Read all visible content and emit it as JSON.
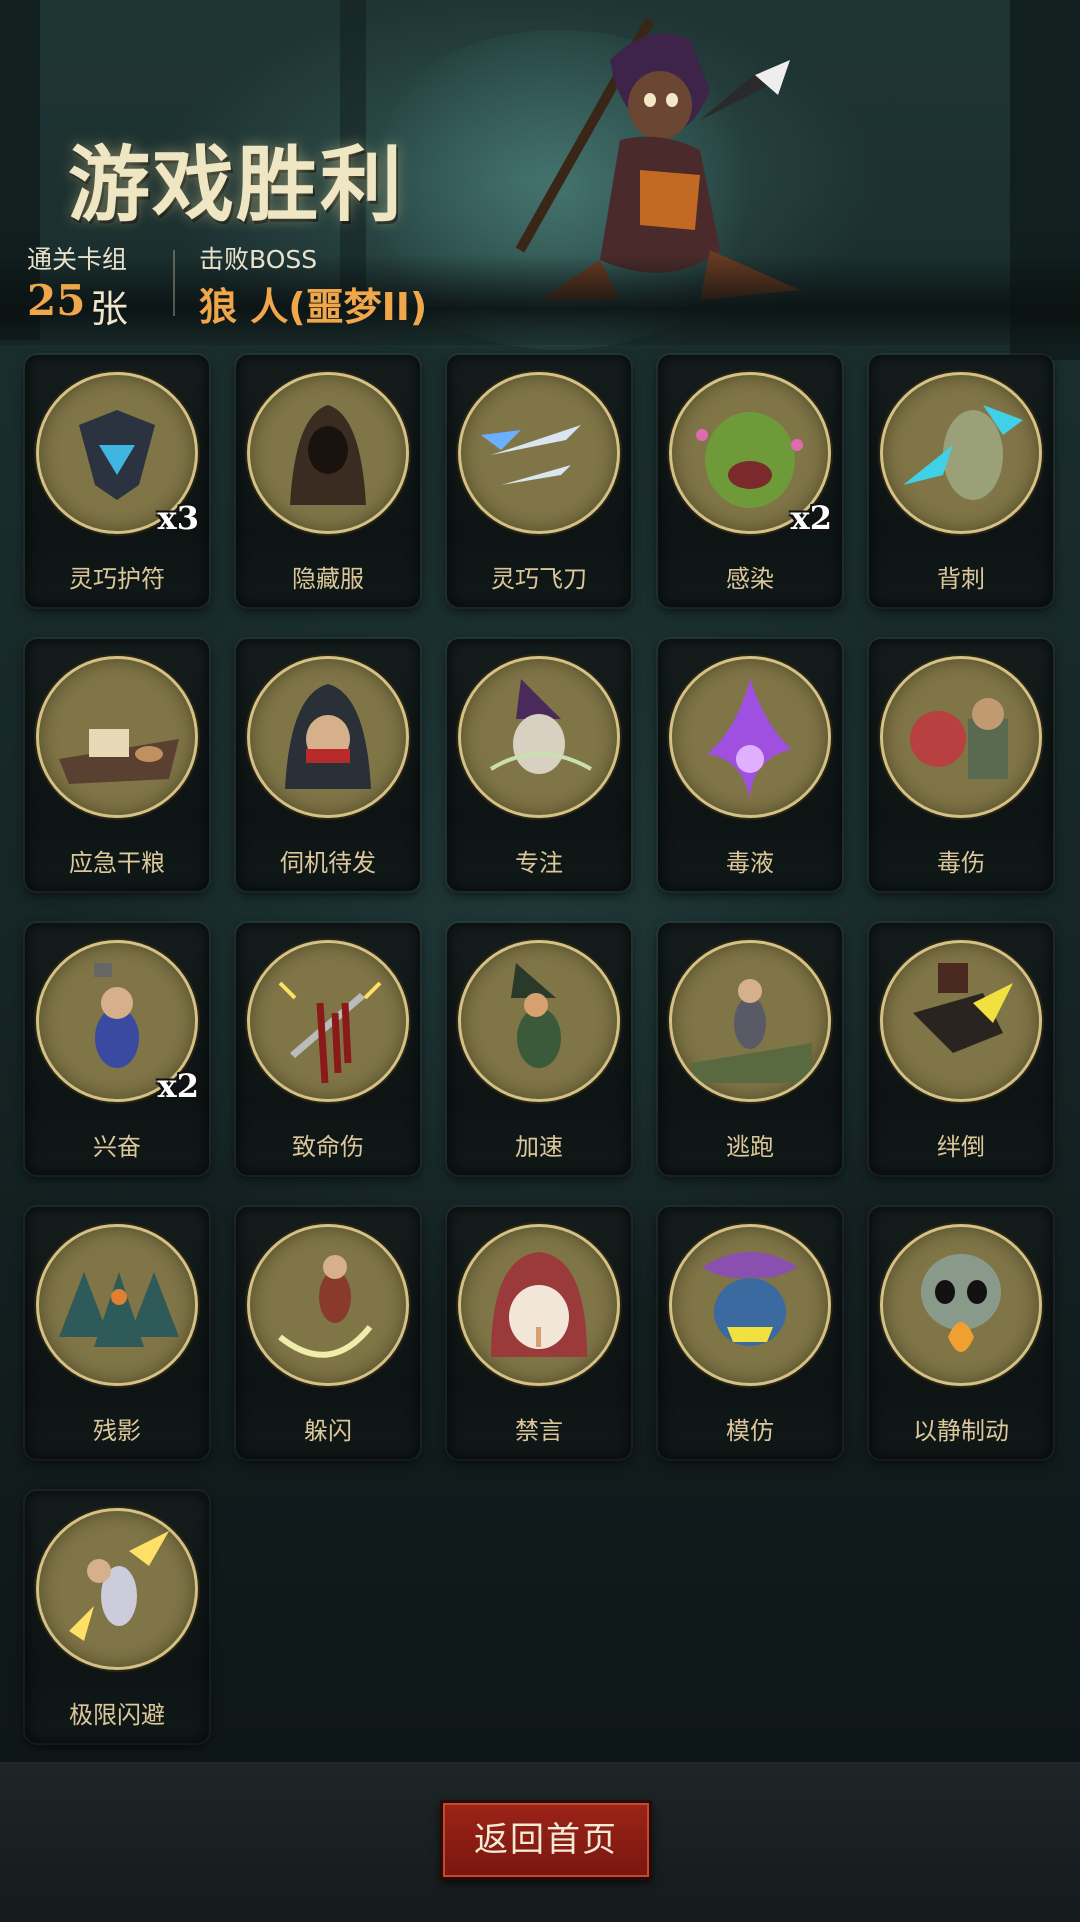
{
  "header": {
    "title": "游戏胜利",
    "cleared_deck_label": "通关卡组",
    "cleared_deck_count": "25",
    "cleared_deck_unit": "张",
    "boss_label": "击败BOSS",
    "boss_name": "狼 人(噩梦II)"
  },
  "cards": [
    {
      "name": "灵巧护符",
      "count": "x3",
      "icon": "amulet-icon"
    },
    {
      "name": "隐藏服",
      "count": "",
      "icon": "hooded-cloak-icon"
    },
    {
      "name": "灵巧飞刀",
      "count": "",
      "icon": "throwing-knives-icon"
    },
    {
      "name": "感染",
      "count": "x2",
      "icon": "infected-monster-icon"
    },
    {
      "name": "背刺",
      "count": "",
      "icon": "backstab-icon"
    },
    {
      "name": "应急干粮",
      "count": "",
      "icon": "rations-icon"
    },
    {
      "name": "伺机待发",
      "count": "",
      "icon": "hooded-rogue-icon"
    },
    {
      "name": "专注",
      "count": "",
      "icon": "wizard-icon"
    },
    {
      "name": "毒液",
      "count": "",
      "icon": "venom-splash-icon"
    },
    {
      "name": "毒伤",
      "count": "",
      "icon": "tentacle-poison-icon"
    },
    {
      "name": "兴奋",
      "count": "x2",
      "icon": "excited-dwarf-icon"
    },
    {
      "name": "致命伤",
      "count": "",
      "icon": "bleeding-dagger-icon"
    },
    {
      "name": "加速",
      "count": "",
      "icon": "running-witch-icon"
    },
    {
      "name": "逃跑",
      "count": "",
      "icon": "fleeing-man-icon"
    },
    {
      "name": "绊倒",
      "count": "",
      "icon": "trip-boot-icon"
    },
    {
      "name": "残影",
      "count": "",
      "icon": "afterimage-icon"
    },
    {
      "name": "躲闪",
      "count": "",
      "icon": "dodge-icon"
    },
    {
      "name": "禁言",
      "count": "",
      "icon": "silence-icon"
    },
    {
      "name": "模仿",
      "count": "",
      "icon": "mimic-goblin-icon"
    },
    {
      "name": "以静制动",
      "count": "",
      "icon": "skull-flame-icon"
    },
    {
      "name": "极限闪避",
      "count": "",
      "icon": "extreme-dodge-icon"
    }
  ],
  "footer": {
    "home_button_label": "返回首页"
  },
  "colors": {
    "accent_orange": "#f0a64a",
    "card_name": "#dcc79a",
    "medal_fill": "#7f7547",
    "button_red": "#9c2418"
  }
}
